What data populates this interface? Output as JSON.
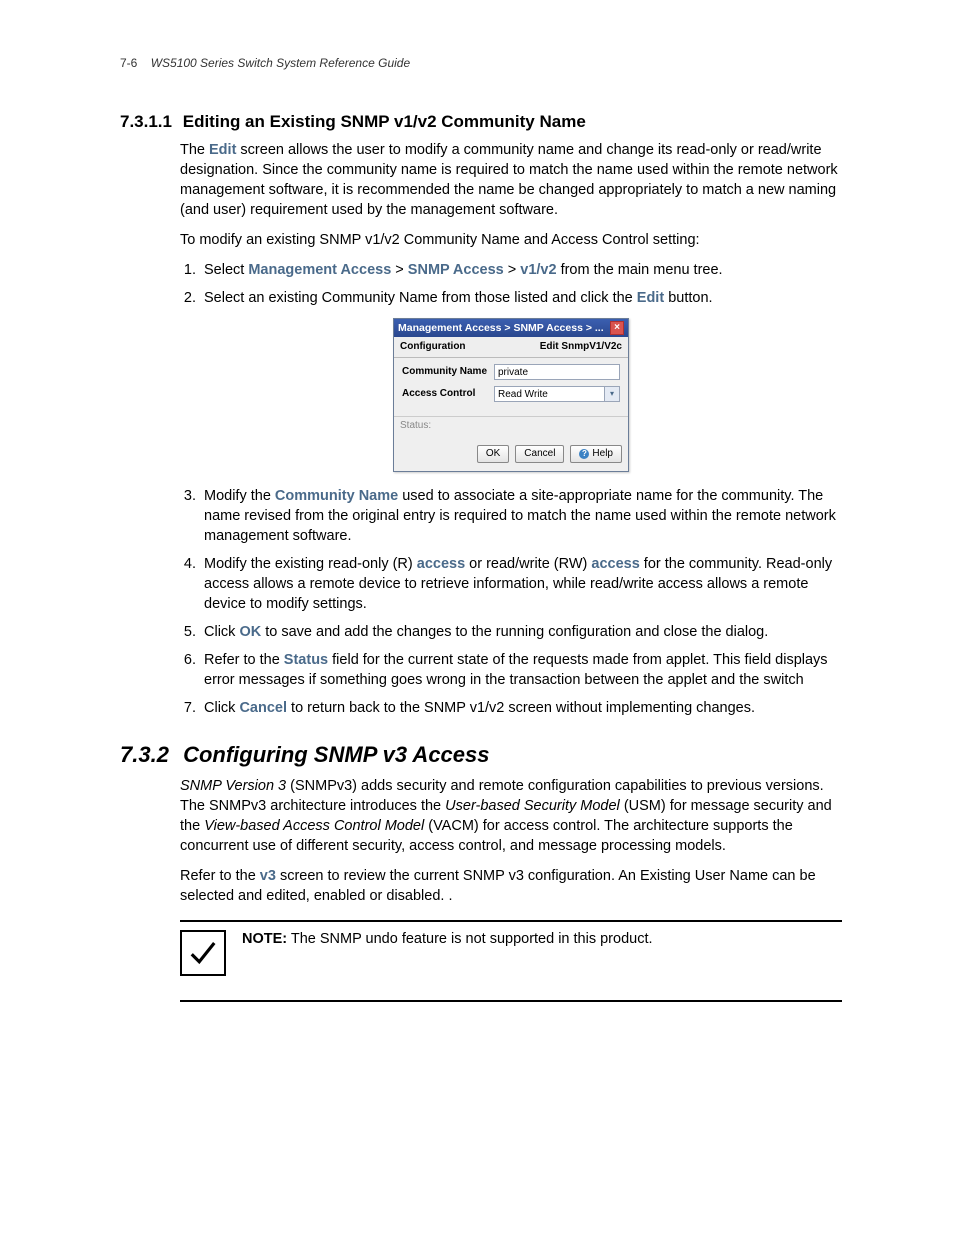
{
  "page": {
    "number": "7-6",
    "running_title": "WS5100 Series Switch System Reference Guide"
  },
  "section1": {
    "number": "7.3.1.1",
    "title": "Editing an Existing SNMP v1/v2 Community Name",
    "p1a": "The ",
    "p1_edit": "Edit",
    "p1b": " screen allows the user to modify a community name and change its read-only or read/write designation. Since the community name is required to match the name used within the remote network management software, it is recommended the name be changed appropriately to match a new naming (and user) requirement used by the management software.",
    "p2": "To modify an existing SNMP v1/v2 Community Name and Access Control setting:",
    "steps": {
      "s1a": "Select ",
      "s1_ma": "Management Access",
      "s1_gt1": " > ",
      "s1_sa": "SNMP Access",
      "s1_gt2": " > ",
      "s1_v12": "v1/v2",
      "s1b": " from the main menu tree.",
      "s2a": "Select an existing Community Name from those listed and click the ",
      "s2_edit": "Edit",
      "s2b": " button.",
      "s3a": "Modify the ",
      "s3_cn": "Community Name",
      "s3b": " used to associate a site-appropriate name for the community. The name revised from the original entry is required to match the name used within the remote network management software.",
      "s4a": "Modify the existing read-only (R) ",
      "s4_acc1": "access",
      "s4b": " or read/write (RW) ",
      "s4_acc2": "access",
      "s4c": " for the community. Read-only access allows a remote device to retrieve information, while read/write access allows a remote device to modify settings.",
      "s5a": "Click ",
      "s5_ok": "OK",
      "s5b": " to save and add the changes to the running configuration and close the dialog.",
      "s6a": "Refer to the ",
      "s6_status": "Status",
      "s6b": " field for the current state of the requests made from applet. This field displays error messages if something goes wrong in the transaction between the applet and the switch",
      "s7a": "Click ",
      "s7_cancel": "Cancel",
      "s7b": " to return back to the SNMP v1/v2 screen without implementing changes."
    }
  },
  "dialog": {
    "title": "Management Access > SNMP Access > ...",
    "config_label": "Configuration",
    "edit_label": "Edit SnmpV1/V2c",
    "community_label": "Community Name",
    "community_value": "private",
    "access_label": "Access Control",
    "access_value": "Read Write",
    "status_label": "Status:",
    "ok": "OK",
    "cancel": "Cancel",
    "help": "Help"
  },
  "section2": {
    "number": "7.3.2",
    "title": "Configuring SNMP v3 Access",
    "p1a": "SNMP Version 3 ",
    "p1b": "(SNMPv3) adds security and remote configuration capabilities to previous versions. The SNMPv3 architecture introduces the ",
    "p1c": "User-based Security Model ",
    "p1d": "(USM) for message security and the ",
    "p1e": "View-based Access Control Model ",
    "p1f": "(VACM) for access control. The architecture supports the concurrent use of different security, access control, and message processing models.",
    "p2a": "Refer to the ",
    "p2_v3": "v3",
    "p2b": " screen to review the current SNMP v3 configuration. An Existing User Name can be selected and edited, enabled or disabled. .",
    "note_label": "NOTE:",
    "note_text": " The SNMP undo feature is not supported in this product."
  }
}
